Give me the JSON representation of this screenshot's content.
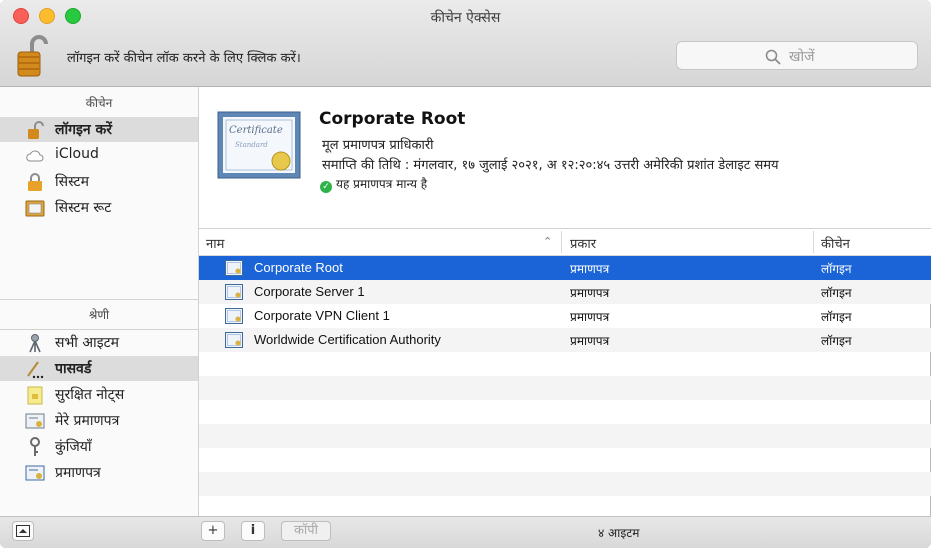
{
  "window": {
    "title": "कीचेन ऐक्सेस"
  },
  "toolbar": {
    "lock_hint": "लॉगइन करें कीचेन लॉक करने के लिए क्लिक करें।",
    "search_placeholder": "खोजें",
    "lock_icon": "lock-open-icon"
  },
  "sidebar": {
    "keychains_header": "कीचेन",
    "keychains": [
      {
        "label": "लॉगइन करें",
        "icon": "lock-open-icon",
        "selected": true
      },
      {
        "label": "iCloud",
        "icon": "cloud-icon",
        "selected": false
      },
      {
        "label": "सिस्टम",
        "icon": "lock-closed-icon",
        "selected": false
      },
      {
        "label": "सिस्टम रूट",
        "icon": "certificate-folder-icon",
        "selected": false
      }
    ],
    "category_header": "श्रेणी",
    "categories": [
      {
        "label": "सभी आइटम",
        "icon": "all-items-icon",
        "selected": false
      },
      {
        "label": "पासवर्ड",
        "icon": "password-icon",
        "selected": true
      },
      {
        "label": "सुरक्षित नोट्स",
        "icon": "secure-note-icon",
        "selected": false
      },
      {
        "label": "मेरे प्रमाणपत्र",
        "icon": "my-certificate-icon",
        "selected": false
      },
      {
        "label": "कुंजियाँ",
        "icon": "key-icon",
        "selected": false
      },
      {
        "label": "प्रमाणपत्र",
        "icon": "certificate-icon",
        "selected": false
      }
    ]
  },
  "detail": {
    "title": "Corporate Root",
    "kind": "मूल प्रमाणपत्र प्राधिकारी",
    "expiry": "समाप्ति की तिथि : मंगलवार, १७ जुलाई २०२१, अ १२:२०:४५ उत्तरी अमेरिकी प्रशांत डेलाइट समय",
    "validity": "यह प्रमाणपत्र मान्य है"
  },
  "table": {
    "columns": [
      "नाम",
      "प्रकार",
      "कीचेन"
    ],
    "rows": [
      {
        "name": "Corporate Root",
        "kind": "प्रमाणपत्र",
        "keychain": "लॉगइन",
        "selected": true
      },
      {
        "name": "Corporate Server 1",
        "kind": "प्रमाणपत्र",
        "keychain": "लॉगइन",
        "selected": false
      },
      {
        "name": "Corporate VPN Client 1",
        "kind": "प्रमाणपत्र",
        "keychain": "लॉगइन",
        "selected": false
      },
      {
        "name": "Worldwide Certification Authority",
        "kind": "प्रमाणपत्र",
        "keychain": "लॉगइन",
        "selected": false
      }
    ]
  },
  "bottom": {
    "add_label": "+",
    "info_label": "i",
    "copy_label": "कॉपी",
    "count": "४ आइटम"
  },
  "colors": {
    "selection": "#1a64d8",
    "sidebar_selection": "#dcdcdc",
    "valid_green": "#2fb24a"
  }
}
